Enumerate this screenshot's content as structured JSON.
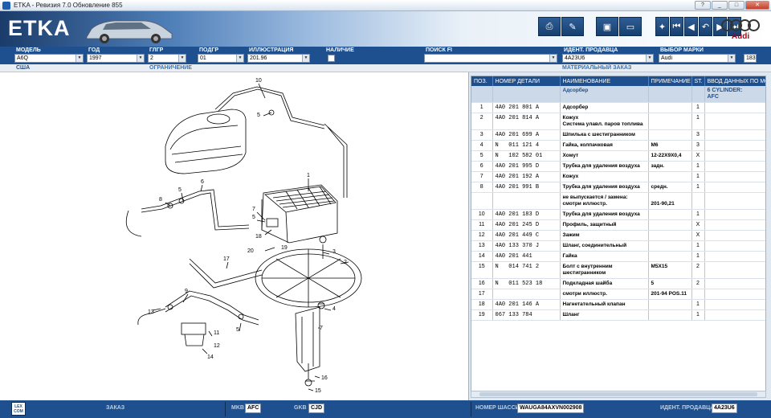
{
  "window": {
    "title": "ETKA - Ревизия 7.0 Обновление 855",
    "buttons": [
      "?",
      "_",
      "□",
      "✕"
    ]
  },
  "banner": {
    "logo": "ETKA",
    "brand": "Audi"
  },
  "filters": {
    "model": {
      "label": "МОДЕЛЬ",
      "value": "A6Q"
    },
    "year": {
      "label": "ГОД",
      "value": "1997"
    },
    "glgr": {
      "label": "ГЛГР",
      "value": "2"
    },
    "podgr": {
      "label": "ПОДГР",
      "value": "01"
    },
    "illustration": {
      "label": "ИЛЛЮСТРАЦИЯ",
      "value": "201.96"
    },
    "availability": {
      "label": "НАЛИЧИЕ"
    },
    "search": {
      "label": "ПОИСК FI",
      "value": ""
    },
    "dealer": {
      "label": "ИДЕНТ. ПРОДАВЦА",
      "value": "4A23U6"
    },
    "brand": {
      "label": "ВЫБОР МАРКИ",
      "value": "Audi",
      "extra": "183"
    }
  },
  "subbar": {
    "region": "США",
    "restriction": "ОГРАНИЧЕНИЕ",
    "material_order": "МАТЕРИАЛЬНЫЙ ЗАКАЗ"
  },
  "diagram": {
    "callouts": [
      "10",
      "5",
      "6",
      "8",
      "5",
      "1",
      "7",
      "5",
      "18",
      "19",
      "20",
      "3",
      "2",
      "17",
      "9",
      "13",
      "11",
      "12",
      "14",
      "5",
      "4",
      "7",
      "16",
      "15"
    ]
  },
  "table": {
    "headers": [
      "ПОЗ.",
      "НОМЕР ДЕТАЛИ",
      "НАИМЕНОВАНИЕ",
      "ПРИМЕЧАНИЕ",
      "ST.",
      "ВВОД ДАННЫХ ПО МО"
    ],
    "rows": [
      {
        "pos": "",
        "pn": "",
        "name": "Адсорбер",
        "note": "",
        "st": "",
        "data": "6 CYLINDER:\nAFC"
      },
      {
        "pos": "1",
        "pn": "4A0 201 801 A",
        "name": "Адсорбер",
        "note": "",
        "st": "1",
        "data": ""
      },
      {
        "pos": "2",
        "pn": "4A0 201 814 A",
        "name": "Кожух\nСистема улавл. паров топлива",
        "note": "",
        "st": "1",
        "data": ""
      },
      {
        "pos": "3",
        "pn": "4A0 201 699 A",
        "name": "Шпилька с шестигранником",
        "note": "",
        "st": "3",
        "data": ""
      },
      {
        "pos": "4",
        "pn": "N   011 121 4",
        "name": "Гайка, колпачковая",
        "note": "M6",
        "st": "3",
        "data": ""
      },
      {
        "pos": "5",
        "pn": "N   102 582 01",
        "name": "Хомут",
        "note": "12-22X9X0,4",
        "st": "X",
        "data": ""
      },
      {
        "pos": "6",
        "pn": "4A0 201 995 D",
        "name": "Трубка для удаления воздуха",
        "note": "задн.",
        "st": "1",
        "data": ""
      },
      {
        "pos": "7",
        "pn": "4A0 201 192 A",
        "name": "Кожух",
        "note": "",
        "st": "1",
        "data": ""
      },
      {
        "pos": "8",
        "pn": "4A0 201 991 B",
        "name": "Трубка для удаления воздуха",
        "note": "средн.",
        "st": "1",
        "data": ""
      },
      {
        "pos": "",
        "pn": "",
        "name": "не выпускается / замена:\nсмотри иллюстр.",
        "note": "\n201-90,21",
        "st": "",
        "data": ""
      },
      {
        "pos": "10",
        "pn": "4A0 201 183 D",
        "name": "Трубка для удаления воздуха",
        "note": "",
        "st": "1",
        "data": ""
      },
      {
        "pos": "11",
        "pn": "4A0 201 245 D",
        "name": "Профиль, защитный",
        "note": "",
        "st": "X",
        "data": ""
      },
      {
        "pos": "12",
        "pn": "4A0 201 449 C",
        "name": "Зажим",
        "note": "",
        "st": "X",
        "data": ""
      },
      {
        "pos": "13",
        "pn": "4A0 133 370 J",
        "name": "Шланг, соединительный",
        "note": "",
        "st": "1",
        "data": ""
      },
      {
        "pos": "14",
        "pn": "4A0 201 441",
        "name": "Гайка",
        "note": "",
        "st": "1",
        "data": ""
      },
      {
        "pos": "15",
        "pn": "N   014 741 2",
        "name": "Болт с внутренним\nшестигранником",
        "note": "M5X15",
        "st": "2",
        "data": ""
      },
      {
        "pos": "16",
        "pn": "N   011 523 18",
        "name": "Подкладная шайба",
        "note": "5",
        "st": "2",
        "data": ""
      },
      {
        "pos": "17",
        "pn": "",
        "name": "смотри иллюстр.",
        "note": "201-94 POS.11",
        "st": "",
        "data": ""
      },
      {
        "pos": "18",
        "pn": "4A0 201 146 A",
        "name": "Нагнетательный клапан",
        "note": "",
        "st": "1",
        "data": ""
      },
      {
        "pos": "19",
        "pn": "067 133 784",
        "name": "Шланг",
        "note": "",
        "st": "1",
        "data": ""
      }
    ]
  },
  "status": {
    "logo": "LEX COM",
    "order": {
      "label": "ЗАКАЗ"
    },
    "mkb": {
      "label": "MKB",
      "value": "AFC"
    },
    "gkb": {
      "label": "GKB",
      "value": "CJD"
    },
    "chassis": {
      "label": "НОМЕР ШАССИ",
      "value": "WAUGA84AXVN002908"
    },
    "dealer": {
      "label": "ИДЕНТ. ПРОДАВЦА",
      "value": "4A23U6"
    }
  }
}
